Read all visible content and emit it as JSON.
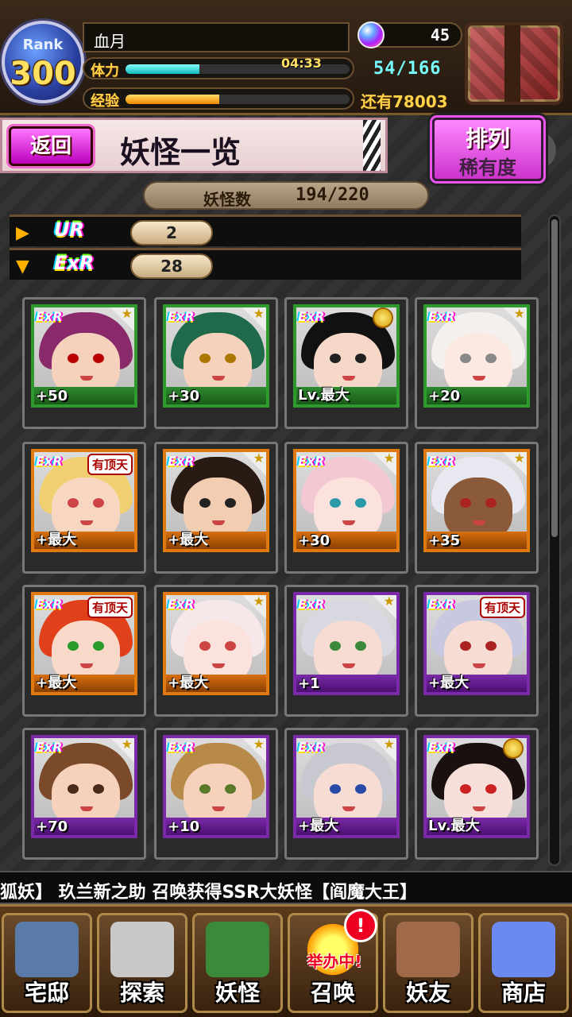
{
  "header": {
    "rank_label": "Rank",
    "rank_value": "300",
    "player_name": "血月",
    "stamina_label": "体力",
    "stamina_timer": "04:33",
    "stamina_count": "54/166",
    "stamina_fraction": 0.33,
    "exp_label": "经验",
    "exp_remaining": "还有78003",
    "exp_fraction": 0.42,
    "gem_count": "45"
  },
  "title_bar": {
    "back_label": "返回",
    "title": "妖怪一览",
    "sort_label": "排列",
    "sort_value": "稀有度"
  },
  "counter": {
    "label": "妖怪数",
    "value": "194/220"
  },
  "rarity_rows": [
    {
      "badge": "UR",
      "count": "2",
      "arrow": "▶"
    },
    {
      "badge": "ExR",
      "count": "28",
      "arrow": "▼"
    }
  ],
  "cards": [
    {
      "rarity": "ExR",
      "frame": "green",
      "level": "+50",
      "corner": "star",
      "hair": "#8a2a6a",
      "eye": "#b00",
      "skin": "#f6d2bd"
    },
    {
      "rarity": "ExR",
      "frame": "green",
      "level": "+30",
      "corner": "star",
      "hair": "#1f6a4a",
      "eye": "#a70",
      "skin": "#f6d2bd"
    },
    {
      "rarity": "ExR",
      "frame": "green",
      "level": "Lv.最大",
      "corner": "medal",
      "hair": "#111",
      "eye": "#222",
      "skin": "#f6d8c8"
    },
    {
      "rarity": "ExR",
      "frame": "green",
      "level": "+20",
      "corner": "star",
      "hair": "#f3f0ee",
      "eye": "#888",
      "skin": "#fbe9e2"
    },
    {
      "rarity": "ExR",
      "frame": "gold",
      "level": "+最大",
      "corner": "tag",
      "tag": "有顶天",
      "hair": "#f0d070",
      "eye": "#c44",
      "skin": "#f7d7c2"
    },
    {
      "rarity": "ExR",
      "frame": "gold",
      "level": "+最大",
      "corner": "star",
      "hair": "#2a1a14",
      "eye": "#222",
      "skin": "#f2cdb2"
    },
    {
      "rarity": "ExR",
      "frame": "gold",
      "level": "+30",
      "corner": "star",
      "hair": "#f3c8d2",
      "eye": "#2a9aa8",
      "skin": "#fbe2dc"
    },
    {
      "rarity": "ExR",
      "frame": "gold",
      "level": "+35",
      "corner": "star",
      "hair": "#e8e8f0",
      "eye": "#a22",
      "skin": "#8a5a3a"
    },
    {
      "rarity": "ExR",
      "frame": "gold",
      "level": "+最大",
      "corner": "tag",
      "tag": "有顶天",
      "hair": "#e0401a",
      "eye": "#2a9a2a",
      "skin": "#f8d8c8"
    },
    {
      "rarity": "ExR",
      "frame": "gold",
      "level": "+最大",
      "corner": "star",
      "hair": "#f6e8e8",
      "eye": "#c44",
      "skin": "#fbe2dc"
    },
    {
      "rarity": "ExR",
      "frame": "purple",
      "level": "+1",
      "corner": "star",
      "hair": "#d8d8e0",
      "eye": "#3a8a3a",
      "skin": "#f6dcd2"
    },
    {
      "rarity": "ExR",
      "frame": "purple",
      "level": "+最大",
      "corner": "tag",
      "tag": "有顶天",
      "hair": "#c8c8e0",
      "eye": "#a22",
      "skin": "#f6dcd2"
    },
    {
      "rarity": "ExR",
      "frame": "purple",
      "level": "+70",
      "corner": "star",
      "hair": "#7a4a2a",
      "eye": "#4a2a1a",
      "skin": "#f6d2bd"
    },
    {
      "rarity": "ExR",
      "frame": "purple",
      "level": "+10",
      "corner": "star",
      "hair": "#b88a4a",
      "eye": "#5a7a2a",
      "skin": "#f6d2bd"
    },
    {
      "rarity": "ExR",
      "frame": "purple",
      "level": "+最大",
      "corner": "star",
      "hair": "#c8c8d0",
      "eye": "#2a4aa8",
      "skin": "#f6dcd2"
    },
    {
      "rarity": "ExR",
      "frame": "purple",
      "level": "Lv.最大",
      "corner": "medal",
      "hair": "#1a1010",
      "eye": "#c22",
      "skin": "#f8e0da"
    }
  ],
  "ticker": {
    "text": "狐妖】    玖兰新之助 召唤获得SSR大妖怪【阎魔大王】"
  },
  "nav": [
    {
      "label": "宅邸",
      "icon": "mansion-icon",
      "color": "#5a7aa8"
    },
    {
      "label": "探索",
      "icon": "magnifier-map-icon",
      "color": "#c8c8c8"
    },
    {
      "label": "妖怪",
      "icon": "scroll-icon",
      "color": "#3a8a3a"
    },
    {
      "label": "召唤",
      "icon": "summon-icon",
      "color": "#f5b000",
      "badge": "!",
      "sub": "举办中!"
    },
    {
      "label": "妖友",
      "icon": "friend-icon",
      "color": "#a06a4a"
    },
    {
      "label": "商店",
      "icon": "crystal-orb-icon",
      "color": "#6a8af0"
    }
  ],
  "colors": {
    "accent_pink": "#dd33cc",
    "stamina_cyan": "#77ffff",
    "exp_gold": "#ffd24a"
  }
}
